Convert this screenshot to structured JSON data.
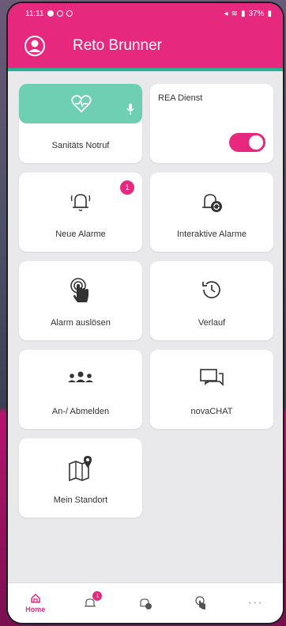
{
  "status": {
    "time": "11:11",
    "battery": "37%"
  },
  "header": {
    "title": "Reto Brunner"
  },
  "tiles": {
    "sos": {
      "label": "Sanitäts Notruf"
    },
    "rea": {
      "label": "REA Dienst",
      "toggle_on": true
    },
    "neue_alarme": {
      "label": "Neue Alarme",
      "badge": "1"
    },
    "interaktive": {
      "label": "Interaktive Alarme"
    },
    "ausloesen": {
      "label": "Alarm auslösen"
    },
    "verlauf": {
      "label": "Verlauf"
    },
    "abmelden": {
      "label": "An-/ Abmelden"
    },
    "chat": {
      "label": "novaCHAT"
    },
    "standort": {
      "label": "Mein Standort"
    }
  },
  "nav": {
    "home": "Home",
    "alarm_badge": "1",
    "more": "···"
  },
  "colors": {
    "brand": "#e6287f",
    "accent": "#6fcfb3",
    "divider": "#27b394"
  }
}
